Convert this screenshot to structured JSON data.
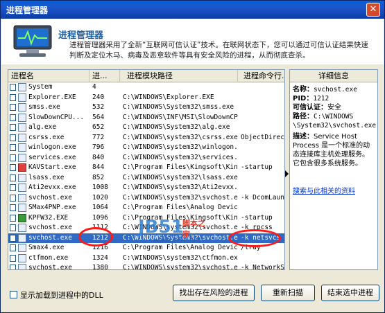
{
  "window": {
    "title": "进程管理器",
    "close_glyph": "✕"
  },
  "header": {
    "title": "进程管理器",
    "description": "进程管理器采用了全新“互联网可信认证”技术。在联网状态下，您可以通过可信认证结果快速判断及定位木马、病毒及恶意软件等具有安全风险的进程，从而彻底查杀。"
  },
  "table": {
    "columns": [
      "进程名",
      "进...",
      "进程模块路径",
      "进程命令行..."
    ],
    "rows": [
      {
        "name": "System",
        "pid": "4",
        "path": "",
        "cmd": ""
      },
      {
        "name": "Explorer.EXE",
        "pid": "240",
        "path": "C:\\WINDOWS\\Explorer.EXE",
        "cmd": ""
      },
      {
        "name": "smss.exe",
        "pid": "532",
        "path": "C:\\WINDOWS\\System32\\smss.exe",
        "cmd": ""
      },
      {
        "name": "SlowDownCPU...",
        "pid": "564",
        "path": "C:\\WINDOWS\\INF\\MSI\\SlowDownCP...",
        "cmd": ""
      },
      {
        "name": "alg.exe",
        "pid": "652",
        "path": "C:\\WINDOWS\\System32\\alg.exe",
        "cmd": ""
      },
      {
        "name": "csrss.exe",
        "pid": "772",
        "path": "C:\\WINDOWS\\system32\\csrss.exe",
        "cmd": "ObjectDirect"
      },
      {
        "name": "winlogon.exe",
        "pid": "796",
        "path": "C:\\WINDOWS\\system32\\winlogon.exe",
        "cmd": ""
      },
      {
        "name": "services.exe",
        "pid": "840",
        "path": "C:\\WINDOWS\\system32\\services.exe",
        "cmd": ""
      },
      {
        "name": "KAVStart.exe",
        "pid": "844",
        "path": "C:\\Program Files\\Kingsoft\\Kin...",
        "cmd": "-startup"
      },
      {
        "name": "lsass.exe",
        "pid": "852",
        "path": "C:\\WINDOWS\\system32\\lsass.exe",
        "cmd": ""
      },
      {
        "name": "Ati2evxx.exe",
        "pid": "1008",
        "path": "C:\\WINDOWS\\system32\\Ati2evxx.exe",
        "cmd": ""
      },
      {
        "name": "svchost.exe",
        "pid": "1020",
        "path": "C:\\WINDOWS\\system32\\svchost.exe",
        "cmd": "-k DcomLaunc"
      },
      {
        "name": "SMax4PNP.exe",
        "pid": "1064",
        "path": "C:\\Program Files\\Analog Devic...",
        "cmd": ""
      },
      {
        "name": "KPFW32.EXE",
        "pid": "1096",
        "path": "C:\\Program Files\\Kingsoft\\Kin...",
        "cmd": "-startup"
      },
      {
        "name": "svchost.exe",
        "pid": "1112",
        "path": "C:\\WINDOWS\\system32\\svchost.exe",
        "cmd": "-k rpcss"
      },
      {
        "name": "svchost.exe",
        "pid": "1212",
        "path": "C:\\WINDOWS\\System32\\svchost.exe",
        "cmd": "-k netsvcs"
      },
      {
        "name": "Smax4.exe",
        "pid": "1216",
        "path": "C:\\Program Files\\Analog Devic...",
        "cmd": "/tray"
      },
      {
        "name": "ctfmon.exe",
        "pid": "1324",
        "path": "C:\\WINDOWS\\system32\\ctfmon.exe",
        "cmd": ""
      },
      {
        "name": "svchost.exe",
        "pid": "1380",
        "path": "C:\\WINDOWS\\system32\\svchost.exe",
        "cmd": "-k NetworkS"
      }
    ]
  },
  "detail": {
    "header": "详细信息",
    "name_label": "名称：",
    "name_value": "svchost.exe",
    "pid_label": "PID：",
    "pid_value": "1212",
    "trust_label": "可信认证：",
    "trust_value": "安全",
    "path_label": "路径：",
    "path_value": "C:\\WINDOWS \\System32\\svchost.exe",
    "desc_label": "描述：",
    "desc_value": "Service Host Process 是一个标准的动态连接库主机处理服务。它包含很多系统服务。",
    "link": "搜索与此相关的资料"
  },
  "footer": {
    "checkbox_label": "显示加载到进程中的DLL",
    "btn_find": "找出存在风险的进程",
    "btn_rescan": "重新扫描",
    "btn_end": "结束选中进程"
  },
  "watermark": {
    "logo": "JB51",
    "site": "www.jb51.net",
    "text": "脚本之家"
  }
}
